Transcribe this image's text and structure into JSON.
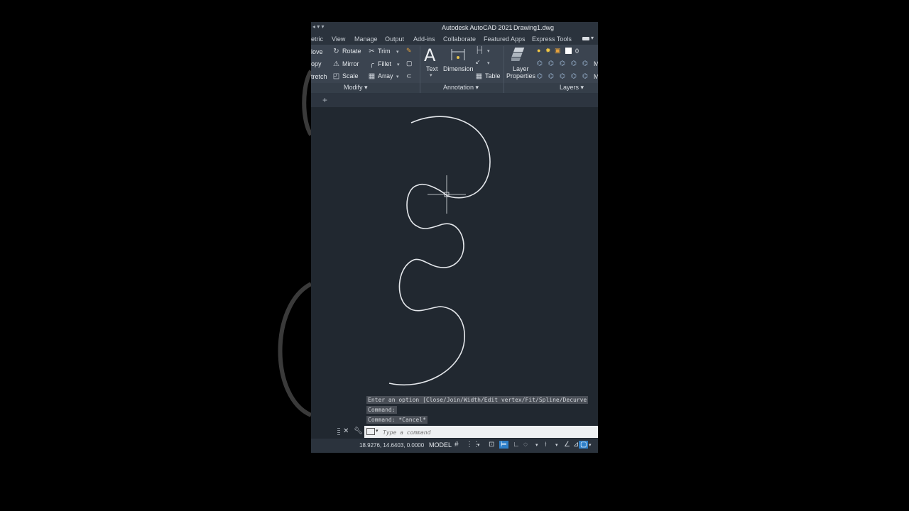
{
  "window": {
    "app_title": "Autodesk AutoCAD 2021",
    "file_name": "Drawing1.dwg"
  },
  "ribbon_tabs": [
    "etric",
    "View",
    "Manage",
    "Output",
    "Add-ins",
    "Collaborate",
    "Featured Apps",
    "Express Tools"
  ],
  "modify_panel": {
    "title": "Modify",
    "commands": [
      "love",
      "Rotate",
      "Trim",
      "opy",
      "Mirror",
      "Fillet",
      "tretch",
      "Scale",
      "Array"
    ]
  },
  "annotation_panel": {
    "title": "Annotation",
    "text_label": "Text",
    "dimension_label": "Dimension",
    "table_label": "Table"
  },
  "layers_panel": {
    "title": "Layers",
    "layer_properties_line1": "Layer",
    "layer_properties_line2": "Properties",
    "current_layer": "0",
    "truncated_1": "M",
    "truncated_2": "M"
  },
  "command_history": [
    "Enter an option [Close/Join/Width/Edit vertex/Fit/Spline/Decurve",
    "Command:",
    "Command: *Cancel*"
  ],
  "command_line": {
    "placeholder": "Type a command"
  },
  "status_bar": {
    "coordinates": "18.9276, 14.6403, 0.0000",
    "space": "MODEL"
  },
  "colors": {
    "canvas": "#212830",
    "ribbon": "#3b4450",
    "accent": "#2f80c9"
  }
}
